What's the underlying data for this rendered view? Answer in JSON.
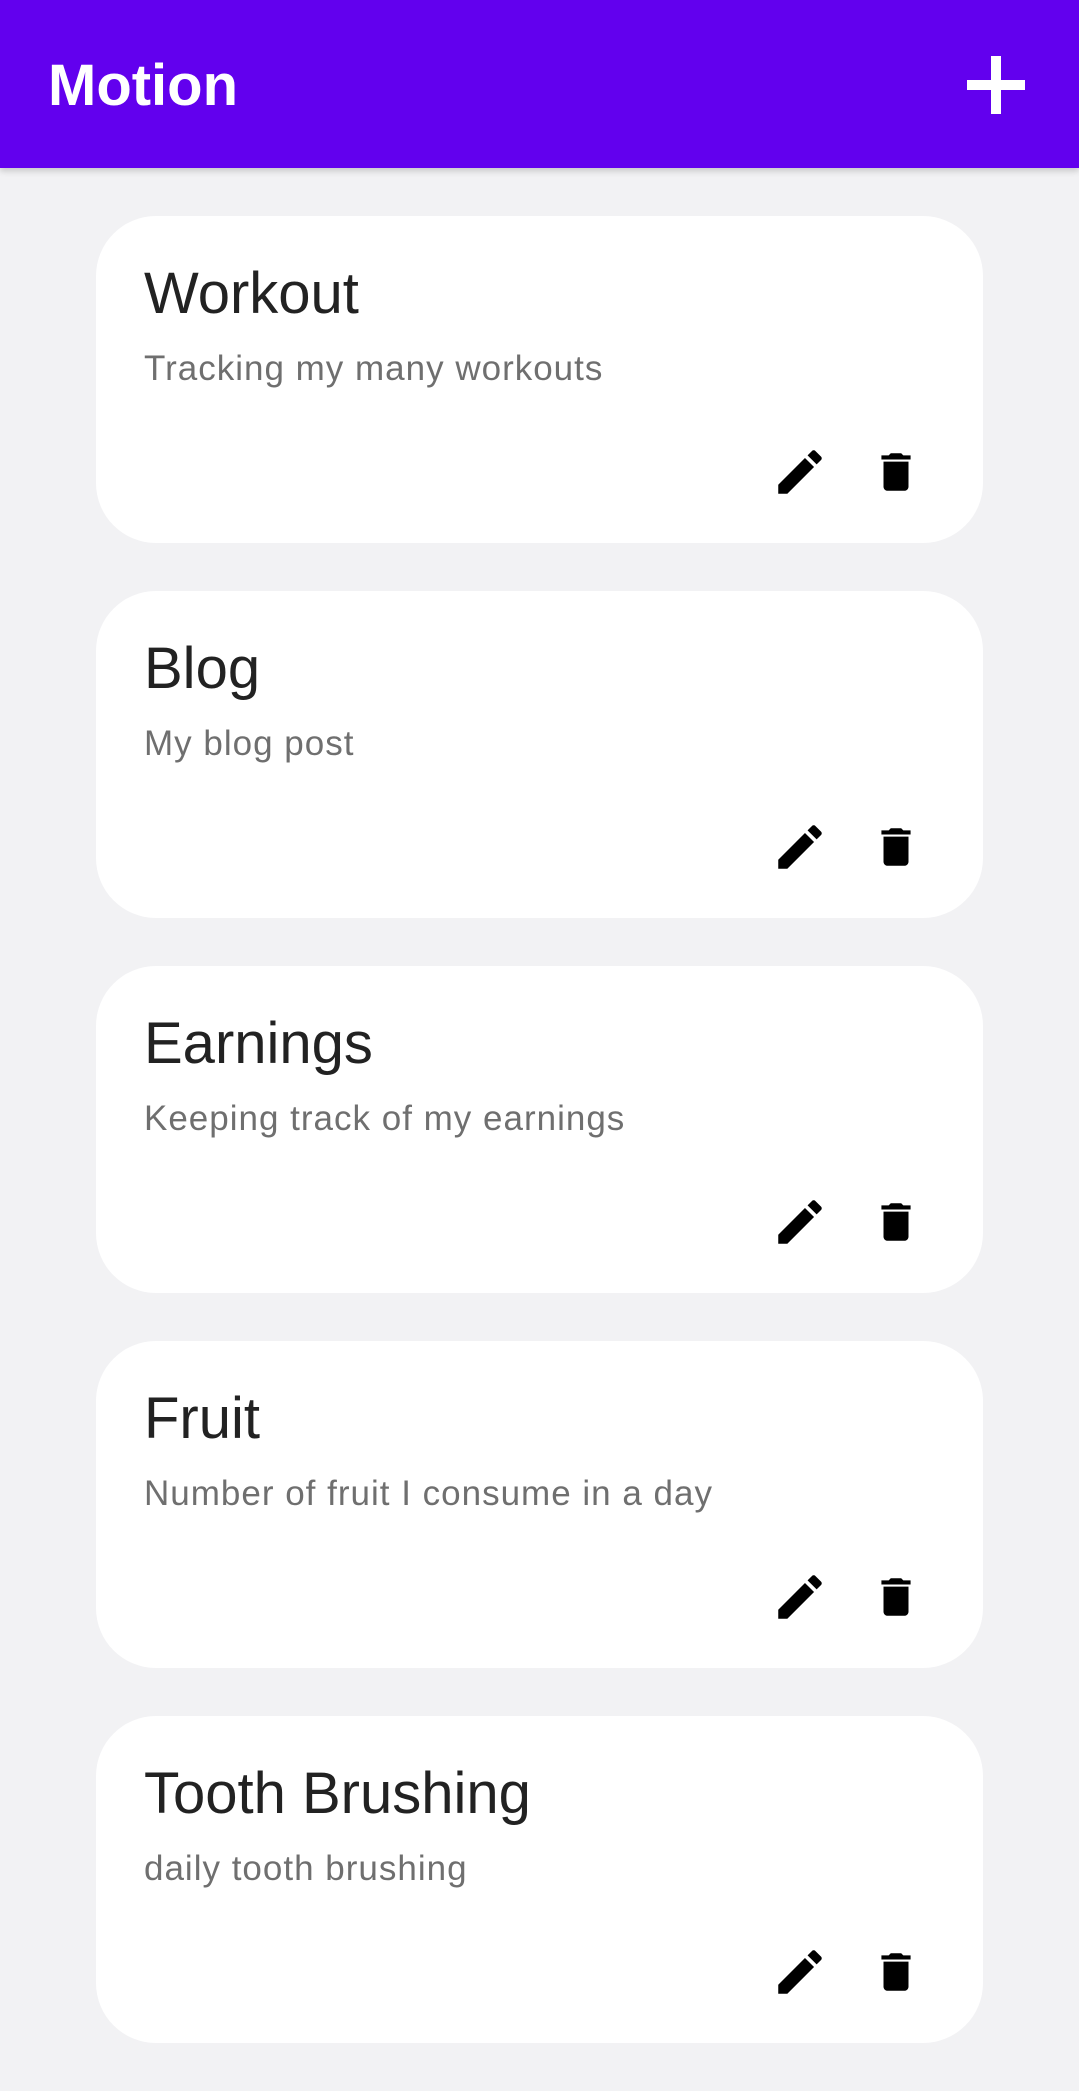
{
  "app_bar": {
    "title": "Motion",
    "add_icon": "plus-icon",
    "background": "#6200ee"
  },
  "cards": [
    {
      "title": "Workout",
      "subtitle": "Tracking my many workouts",
      "edit_icon": "pencil-icon",
      "delete_icon": "trash-icon"
    },
    {
      "title": "Blog",
      "subtitle": "My blog post",
      "edit_icon": "pencil-icon",
      "delete_icon": "trash-icon"
    },
    {
      "title": "Earnings",
      "subtitle": "Keeping track of my earnings",
      "edit_icon": "pencil-icon",
      "delete_icon": "trash-icon"
    },
    {
      "title": "Fruit",
      "subtitle": "Number of fruit I consume in a day",
      "edit_icon": "pencil-icon",
      "delete_icon": "trash-icon"
    },
    {
      "title": "Tooth Brushing",
      "subtitle": "daily tooth brushing",
      "edit_icon": "pencil-icon",
      "delete_icon": "trash-icon"
    }
  ],
  "colors": {
    "page_background": "#f2f2f4",
    "card_background": "#ffffff",
    "title_text": "#222222",
    "subtitle_text": "#6f6f6f",
    "icon": "#000000"
  }
}
